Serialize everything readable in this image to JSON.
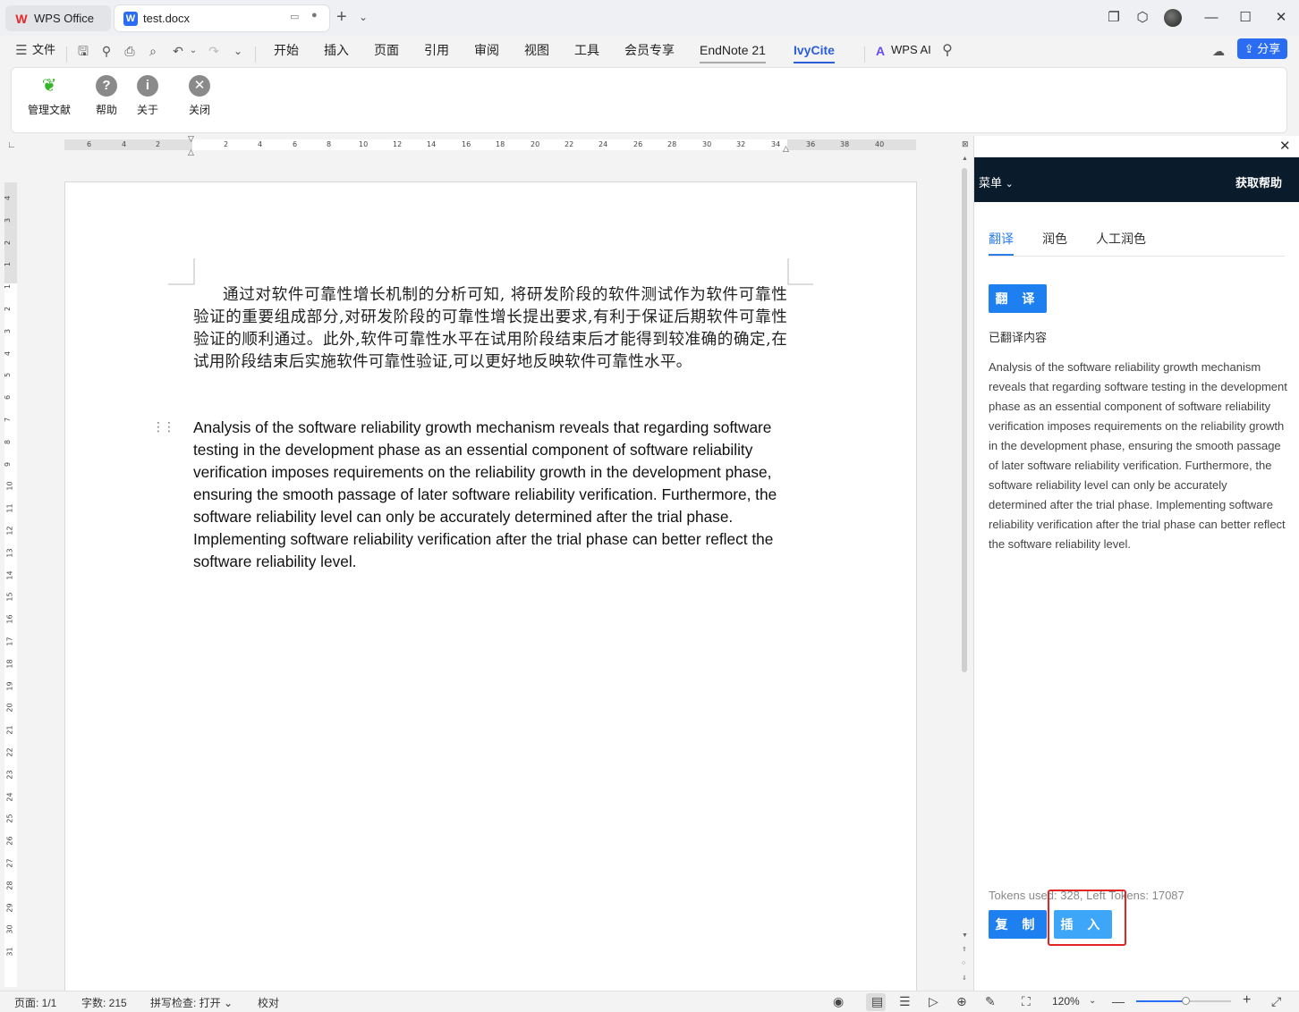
{
  "titlebar": {
    "tabs": [
      {
        "label": "WPS Office"
      },
      {
        "label": "test.docx"
      }
    ]
  },
  "menu": {
    "file": "文件",
    "items": [
      "开始",
      "插入",
      "页面",
      "引用",
      "审阅",
      "视图",
      "工具",
      "会员专享",
      "EndNote 21",
      "IvyCite"
    ],
    "active": "IvyCite",
    "wps_ai": "WPS AI",
    "share": "分享"
  },
  "ribbon": {
    "buttons": [
      "管理文献",
      "帮助",
      "关于",
      "关闭"
    ]
  },
  "document": {
    "chinese_paragraph": "通过对软件可靠性增长机制的分析可知, 将研发阶段的软件测试作为软件可靠性验证的重要组成部分,对研发阶段的可靠性增长提出要求,有利于保证后期软件可靠性验证的顺利通过。此外,软件可靠性水平在试用阶段结束后才能得到较准确的确定,在试用阶段结束后实施软件可靠性验证,可以更好地反映软件可靠性水平。",
    "english_paragraph": "Analysis of the software reliability growth mechanism reveals that regarding software testing in the development phase as an essential component of software reliability verification imposes requirements on the reliability growth in the development phase, ensuring the smooth passage of later software reliability verification. Furthermore, the software reliability level can only be accurately determined after the trial phase. Implementing software reliability verification after the trial phase can better reflect the software reliability level."
  },
  "ruler": {
    "top_ticks": [
      "6",
      "4",
      "2",
      "2",
      "4",
      "6",
      "8",
      "10",
      "12",
      "14",
      "16",
      "18",
      "20",
      "22",
      "24",
      "26",
      "28",
      "30",
      "32",
      "34",
      "36",
      "38",
      "40"
    ],
    "left_ticks": [
      "4",
      "3",
      "2",
      "1",
      "1",
      "2",
      "3",
      "4",
      "5",
      "6",
      "7",
      "8",
      "9",
      "10",
      "11",
      "12",
      "13",
      "14",
      "15",
      "16",
      "17",
      "18",
      "19",
      "20",
      "21",
      "22",
      "23",
      "24",
      "25",
      "26",
      "27",
      "28",
      "29",
      "30",
      "31"
    ]
  },
  "panel": {
    "menu_label": "菜单",
    "help_label": "获取帮助",
    "tabs": [
      "翻译",
      "润色",
      "人工润色"
    ],
    "active_tab": "翻译",
    "translate_button": "翻 译",
    "translated_label": "已翻译内容",
    "translated_text": "Analysis of the software reliability growth mechanism reveals that regarding software testing in the development phase as an essential component of software reliability verification imposes requirements on the reliability growth in the development phase, ensuring the smooth passage of later software reliability verification. Furthermore, the software reliability level can only be accurately determined after the trial phase. Implementing software reliability verification after the trial phase can better reflect the software reliability level.",
    "tokens": "Tokens used: 328, Left Tokens: 17087",
    "copy_button": "复 制",
    "insert_button": "插 入"
  },
  "status": {
    "page": "页面: 1/1",
    "words": "字数: 215",
    "spellcheck": "拼写检查: 打开",
    "proof": "校对",
    "zoom": "120%",
    "zoom_fraction": 0.52
  },
  "colors": {
    "accent": "#2b6df2",
    "panel_header": "#0a1b2c",
    "panel_button": "#1e7ff0",
    "highlight_box": "#e12424"
  }
}
